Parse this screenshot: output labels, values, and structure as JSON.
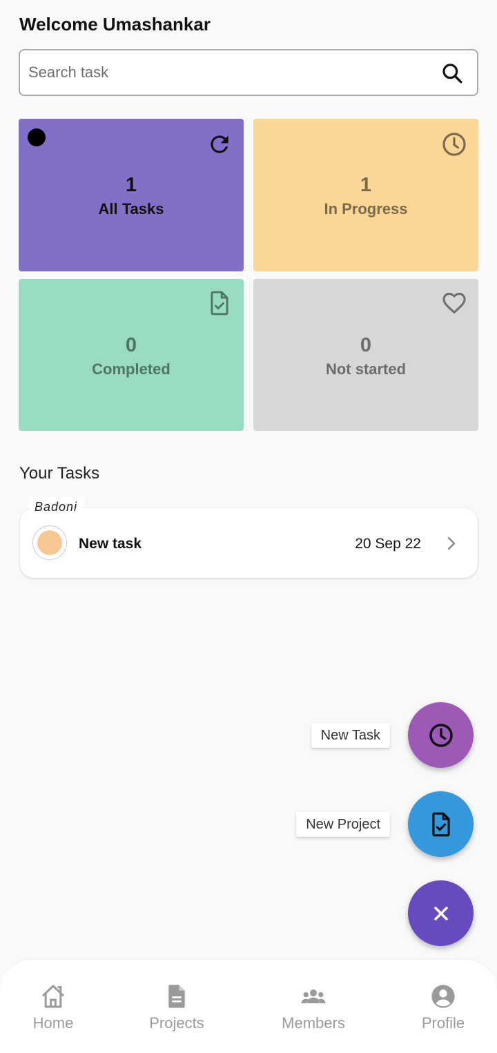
{
  "header": {
    "welcome_text": "Welcome Umashankar"
  },
  "search": {
    "placeholder": "Search task",
    "value": ""
  },
  "summary_cards": [
    {
      "count": "1",
      "label": "All Tasks",
      "icon": "refresh-icon",
      "color": "#836fc8"
    },
    {
      "count": "1",
      "label": "In Progress",
      "icon": "clock-icon",
      "color": "#fad796"
    },
    {
      "count": "0",
      "label": "Completed",
      "icon": "document-check-icon",
      "color": "#99dcc2"
    },
    {
      "count": "0",
      "label": "Not started",
      "icon": "heart-icon",
      "color": "#d7d7d7"
    }
  ],
  "tasks_section": {
    "title": "Your Tasks",
    "items": [
      {
        "tag": "Badoni",
        "name": "New task",
        "date": "20 Sep 22",
        "status_color": "#f7c894"
      }
    ]
  },
  "fab_menu": {
    "new_task_label": "New Task",
    "new_project_label": "New Project"
  },
  "bottom_nav": {
    "items": [
      {
        "label": "Home",
        "icon": "home-icon"
      },
      {
        "label": "Projects",
        "icon": "document-icon"
      },
      {
        "label": "Members",
        "icon": "people-icon"
      },
      {
        "label": "Profile",
        "icon": "account-icon"
      }
    ]
  }
}
